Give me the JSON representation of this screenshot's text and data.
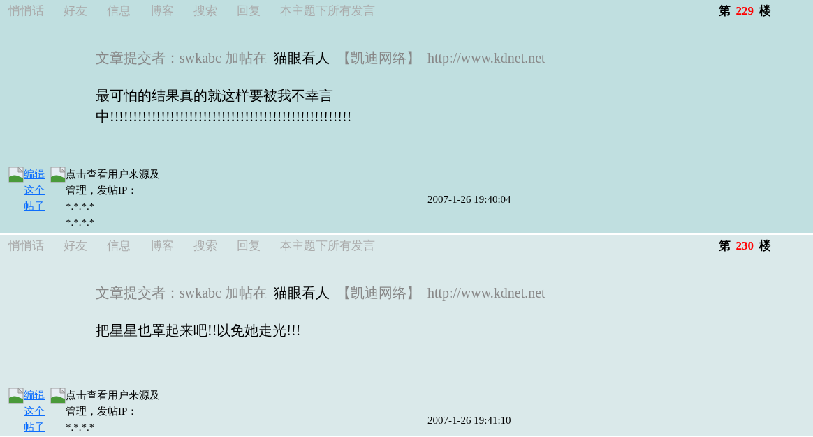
{
  "posts": [
    {
      "toolbar": [
        "悄悄话",
        "好友",
        "信息",
        "博客",
        "搜索",
        "回复",
        "本主题下所有发言"
      ],
      "floor": {
        "prefix": "第",
        "number": "229",
        "suffix": "楼"
      },
      "submitter": {
        "label": "文章提交者：swkabc 加帖在",
        "board": "猫眼看人",
        "site": "【凯迪网络】",
        "url": "http://www.kdnet.net"
      },
      "body": "最可怕的结果真的就这样要被我不幸言中!!!!!!!!!!!!!!!!!!!!!!!!!!!!!!!!!!!!!!!!!!!!!!!!!!!!",
      "edit_alt": "编辑这个帖子",
      "source_alt": "点击查看用户来源及管理，发帖IP：",
      "ip_lines": [
        "*.*.*.*",
        "*.*.*.*"
      ],
      "time": "2007-1-26 19:40:04"
    },
    {
      "toolbar": [
        "悄悄话",
        "好友",
        "信息",
        "博客",
        "搜索",
        "回复",
        "本主题下所有发言"
      ],
      "floor": {
        "prefix": "第",
        "number": "230",
        "suffix": "楼"
      },
      "submitter": {
        "label": "文章提交者：swkabc 加帖在",
        "board": "猫眼看人",
        "site": "【凯迪网络】",
        "url": "http://www.kdnet.net"
      },
      "body": "把星星也罩起来吧!!以免她走光!!!",
      "edit_alt": "编辑这个帖子",
      "source_alt": "点击查看用户来源及管理，发帖IP：",
      "ip_lines": [
        "*.*.*.*"
      ],
      "time": "2007-1-26 19:41:10"
    }
  ]
}
